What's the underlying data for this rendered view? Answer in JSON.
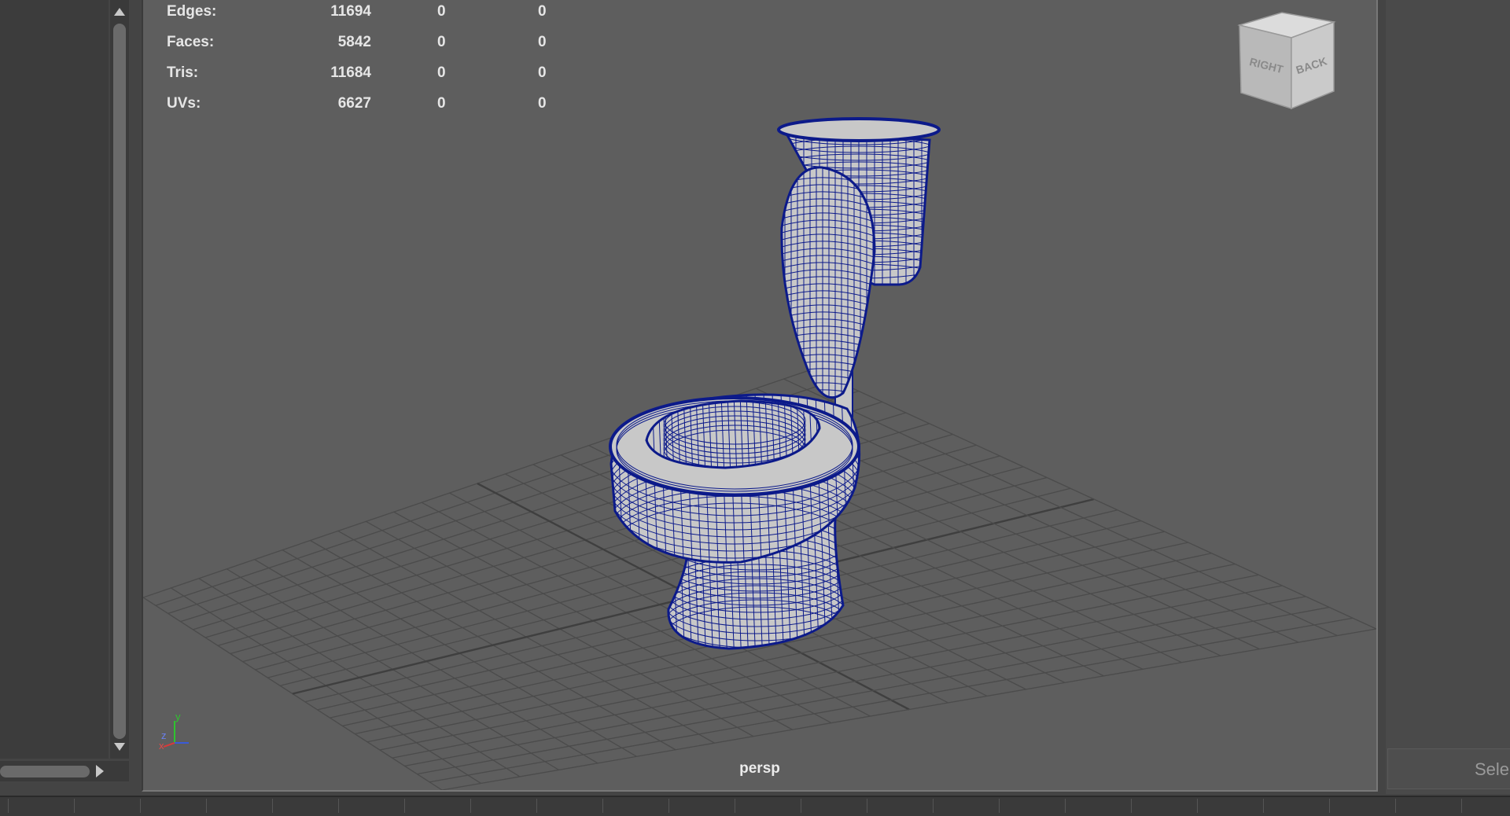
{
  "outliner": {},
  "viewport": {
    "camera_label": "persp",
    "hud": {
      "rows": [
        {
          "label": "Edges:",
          "value": "11694",
          "selected": "0",
          "uv": "0"
        },
        {
          "label": "Faces:",
          "value": "5842",
          "selected": "0",
          "uv": "0"
        },
        {
          "label": "Tris:",
          "value": "11684",
          "selected": "0",
          "uv": "0"
        },
        {
          "label": "UVs:",
          "value": "6627",
          "selected": "0",
          "uv": "0"
        }
      ]
    },
    "viewcube": {
      "face_right": "RIGHT",
      "face_back": "BACK"
    },
    "axis": {
      "x": "x",
      "y": "y",
      "z": "z"
    },
    "wireframe_color": "#0c1a8a",
    "mesh_fill_color": "#c8c8c8"
  },
  "right_panel": {
    "select_button_label": "Sele"
  }
}
